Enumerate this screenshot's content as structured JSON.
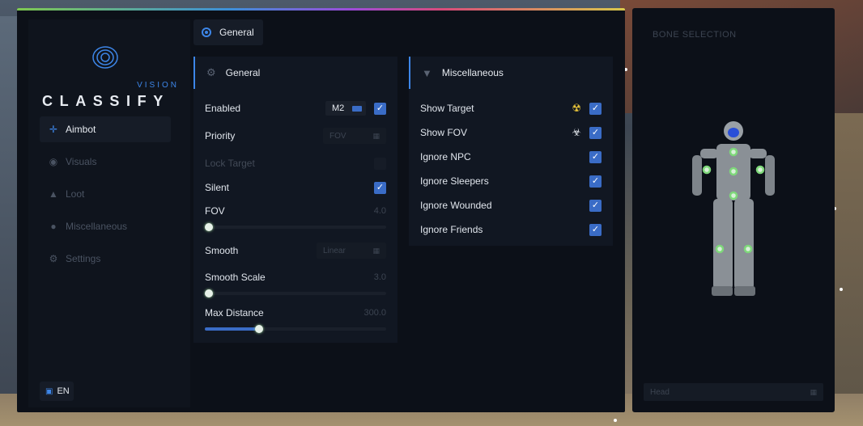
{
  "brand": {
    "subtitle": "VISION",
    "title": "CLASSIFY"
  },
  "sidebar": {
    "items": [
      {
        "label": "Aimbot",
        "icon": "crosshair-icon",
        "active": true
      },
      {
        "label": "Visuals",
        "icon": "eye-icon",
        "active": false
      },
      {
        "label": "Loot",
        "icon": "bag-icon",
        "active": false
      },
      {
        "label": "Miscellaneous",
        "icon": "dots-icon",
        "active": false
      },
      {
        "label": "Settings",
        "icon": "gear-icon",
        "active": false
      }
    ],
    "language": "EN"
  },
  "tabs": [
    {
      "label": "General",
      "icon": "target-icon",
      "active": true
    }
  ],
  "general_panel": {
    "title": "General",
    "enabled": {
      "label": "Enabled",
      "key": "M2",
      "checked": true
    },
    "priority": {
      "label": "Priority",
      "value": "FOV"
    },
    "lock_target": {
      "label": "Lock Target",
      "checked": false,
      "disabled": true
    },
    "silent": {
      "label": "Silent",
      "checked": true
    },
    "fov": {
      "label": "FOV",
      "value": "4.0",
      "fraction": 0.0
    },
    "smooth": {
      "label": "Smooth",
      "value": "Linear"
    },
    "smooth_scale": {
      "label": "Smooth Scale",
      "value": "3.0",
      "fraction": 0.02
    },
    "max_distance": {
      "label": "Max Distance",
      "value": "300.0",
      "fraction": 0.3
    }
  },
  "misc_panel": {
    "title": "Miscellaneous",
    "items": [
      {
        "label": "Show Target",
        "checked": true,
        "hazard": "yellow"
      },
      {
        "label": "Show FOV",
        "checked": true,
        "hazard": "white"
      },
      {
        "label": "Ignore NPC",
        "checked": true
      },
      {
        "label": "Ignore Sleepers",
        "checked": true
      },
      {
        "label": "Ignore Wounded",
        "checked": true
      },
      {
        "label": "Ignore Friends",
        "checked": true
      }
    ]
  },
  "bone_selection": {
    "title": "BONE SELECTION",
    "selected": "Head"
  },
  "colors": {
    "accent": "#3d86e8",
    "checkbox": "#3a6cc6",
    "hazard_yellow": "#e8c43a"
  }
}
